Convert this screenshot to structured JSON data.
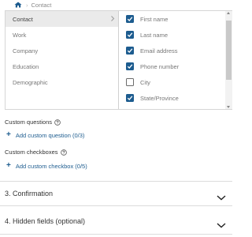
{
  "breadcrumb": {
    "current": "Contact",
    "separator": "›"
  },
  "categories": [
    {
      "label": "Contact",
      "active": true
    },
    {
      "label": "Work",
      "active": false
    },
    {
      "label": "Company",
      "active": false
    },
    {
      "label": "Education",
      "active": false
    },
    {
      "label": "Demographic",
      "active": false
    }
  ],
  "fields": [
    {
      "label": "First name",
      "checked": true
    },
    {
      "label": "Last name",
      "checked": true
    },
    {
      "label": "Email address",
      "checked": true
    },
    {
      "label": "Phone number",
      "checked": true
    },
    {
      "label": "City",
      "checked": false
    },
    {
      "label": "State/Province",
      "checked": true
    }
  ],
  "custom_questions": {
    "label": "Custom questions",
    "add_label": "Add custom question (0/3)"
  },
  "custom_checkboxes": {
    "label": "Custom checkboxes",
    "add_label": "Add custom checkbox (0/5)"
  },
  "sections": [
    {
      "label": "3.  Confirmation"
    },
    {
      "label": "4.  Hidden fields (optional)"
    }
  ],
  "colors": {
    "accent": "#1d5c8f",
    "active_row": "#eaeaea"
  },
  "icons": {
    "home": "home-icon",
    "help": "help-circle-icon",
    "expand": "chevron-down-icon"
  }
}
